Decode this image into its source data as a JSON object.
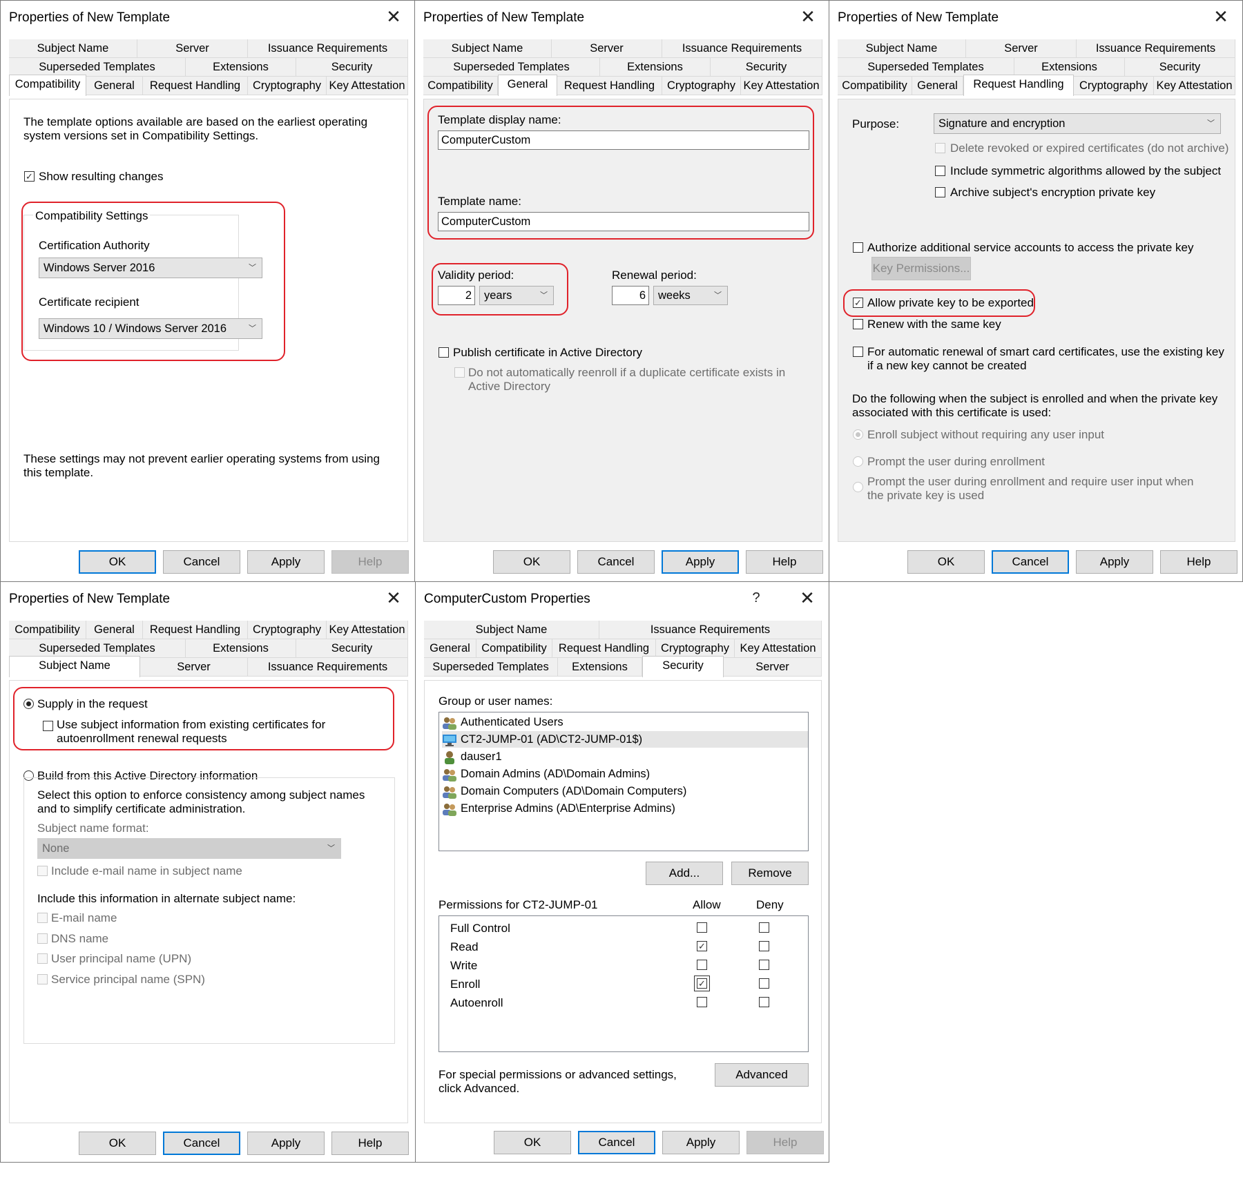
{
  "common": {
    "ok": "OK",
    "cancel": "Cancel",
    "apply": "Apply",
    "help": "Help",
    "close_glyph": "✕"
  },
  "d1": {
    "title": "Properties of New Template",
    "tabs_row1": [
      "Subject Name",
      "Server",
      "Issuance Requirements"
    ],
    "tabs_row2": [
      "Superseded Templates",
      "Extensions",
      "Security"
    ],
    "tabs_row3": [
      "Compatibility",
      "General",
      "Request Handling",
      "Cryptography",
      "Key Attestation"
    ],
    "intro": "The template options available are based on the earliest operating system versions set in Compatibility Settings.",
    "show_changes": "Show resulting changes",
    "group": "Compatibility Settings",
    "ca_label": "Certification Authority",
    "ca_value": "Windows Server 2016",
    "recipient_label": "Certificate recipient",
    "recipient_value": "Windows 10 / Windows Server 2016",
    "footer": "These settings may not prevent earlier operating systems from using this template."
  },
  "d2": {
    "title": "Properties of New Template",
    "tabs_row1": [
      "Subject Name",
      "Server",
      "Issuance Requirements"
    ],
    "tabs_row2": [
      "Superseded Templates",
      "Extensions",
      "Security"
    ],
    "tabs_row3": [
      "Compatibility",
      "General",
      "Request Handling",
      "Cryptography",
      "Key Attestation"
    ],
    "display_name_label": "Template display name:",
    "display_name_value": "ComputerCustom",
    "name_label": "Template name:",
    "name_value": "ComputerCustom",
    "validity_label": "Validity period:",
    "validity_num": "2",
    "validity_unit": "years",
    "renewal_label": "Renewal period:",
    "renewal_num": "6",
    "renewal_unit": "weeks",
    "publish": "Publish certificate in Active Directory",
    "no_reenroll": "Do not automatically reenroll if a duplicate certificate exists in Active Directory"
  },
  "d3": {
    "title": "Properties of New Template",
    "tabs_row1": [
      "Subject Name",
      "Server",
      "Issuance Requirements"
    ],
    "tabs_row2": [
      "Superseded Templates",
      "Extensions",
      "Security"
    ],
    "tabs_row3": [
      "Compatibility",
      "General",
      "Request Handling",
      "Cryptography",
      "Key Attestation"
    ],
    "purpose_label": "Purpose:",
    "purpose_value": "Signature and encryption",
    "delete_revoked": "Delete revoked or expired certificates (do not archive)",
    "include_symmetric": "Include symmetric algorithms allowed by the subject",
    "archive_key": "Archive subject's encryption private key",
    "authorize_accounts": "Authorize additional service accounts to access the private key",
    "key_permissions": "Key Permissions...",
    "allow_export": "Allow private key to be exported",
    "renew_same": "Renew with the same key",
    "smartcard": "For automatic renewal of smart card certificates, use the existing key if a new key cannot be created",
    "do_following": "Do the following when the subject is enrolled and when the private key associated with this certificate is used:",
    "opt1": "Enroll subject without requiring any user input",
    "opt2": "Prompt the user during enrollment",
    "opt3": "Prompt the user during enrollment and require user input when the private key is used"
  },
  "d4": {
    "title": "Properties of New Template",
    "tabs_row1": [
      "Compatibility",
      "General",
      "Request Handling",
      "Cryptography",
      "Key Attestation"
    ],
    "tabs_row2": [
      "Superseded Templates",
      "Extensions",
      "Security"
    ],
    "tabs_row3": [
      "Subject Name",
      "Server",
      "Issuance Requirements"
    ],
    "supply": "Supply in the request",
    "use_existing": "Use subject information from existing certificates for autoenrollment renewal requests",
    "build": "Build from this Active Directory information",
    "build_desc": "Select this option to enforce consistency among subject names and to simplify certificate administration.",
    "format_label": "Subject name format:",
    "format_value": "None",
    "include_email": "Include e-mail name in subject name",
    "alt_label": "Include this information in alternate subject name:",
    "alt_items": [
      "E-mail name",
      "DNS name",
      "User principal name (UPN)",
      "Service principal name (SPN)"
    ]
  },
  "d5": {
    "title": "ComputerCustom Properties",
    "help_glyph": "?",
    "tabs_row1": [
      "Subject Name",
      "Issuance Requirements"
    ],
    "tabs_row2": [
      "General",
      "Compatibility",
      "Request Handling",
      "Cryptography",
      "Key Attestation"
    ],
    "tabs_row3": [
      "Superseded Templates",
      "Extensions",
      "Security",
      "Server"
    ],
    "group_label": "Group or user names:",
    "users": [
      "Authenticated Users",
      "CT2-JUMP-01 (AD\\CT2-JUMP-01$)",
      "dauser1",
      "Domain Admins (AD\\Domain Admins)",
      "Domain Computers (AD\\Domain Computers)",
      "Enterprise Admins (AD\\Enterprise Admins)"
    ],
    "add": "Add...",
    "remove": "Remove",
    "perm_label": "Permissions for CT2-JUMP-01",
    "allow": "Allow",
    "deny": "Deny",
    "permissions": [
      "Full Control",
      "Read",
      "Write",
      "Enroll",
      "Autoenroll"
    ],
    "special": "For special permissions or advanced settings, click Advanced.",
    "advanced": "Advanced"
  },
  "colors": {
    "highlight": "#e0222a",
    "default_button": "#0078d7",
    "dialog_bg": "#f0f0f0"
  }
}
